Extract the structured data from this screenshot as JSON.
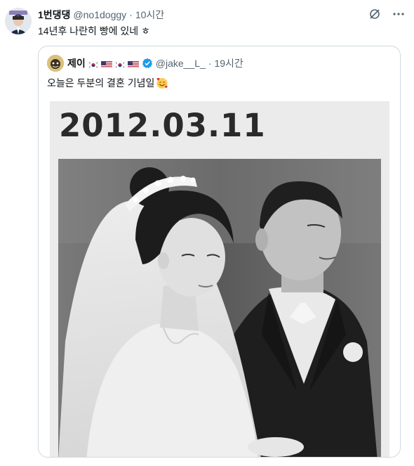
{
  "tweet": {
    "author_name": "1번댕댕",
    "author_handle": "@no1doggy",
    "separator": "·",
    "time": "10시간",
    "text": "14년후 나란히 빵에 있네 ㅎ"
  },
  "quoted": {
    "author_name": "제이",
    "author_handle": "@jake__L_",
    "separator": "·",
    "time": "19시간",
    "text": "오늘은 두분의 결혼 기념일",
    "emoji": "smiling-face-with-hearts-icon",
    "flags": [
      "south-korea-flag-icon",
      "usa-flag-icon",
      "south-korea-flag-icon",
      "usa-flag-icon"
    ],
    "verified": true
  },
  "media": {
    "date_caption": "2012.03.11",
    "photo": "black-and-white wedding photo"
  },
  "colors": {
    "text": "#0f1419",
    "secondary": "#536471",
    "border": "#cfd9de",
    "verified_blue": "#1d9bf0"
  }
}
